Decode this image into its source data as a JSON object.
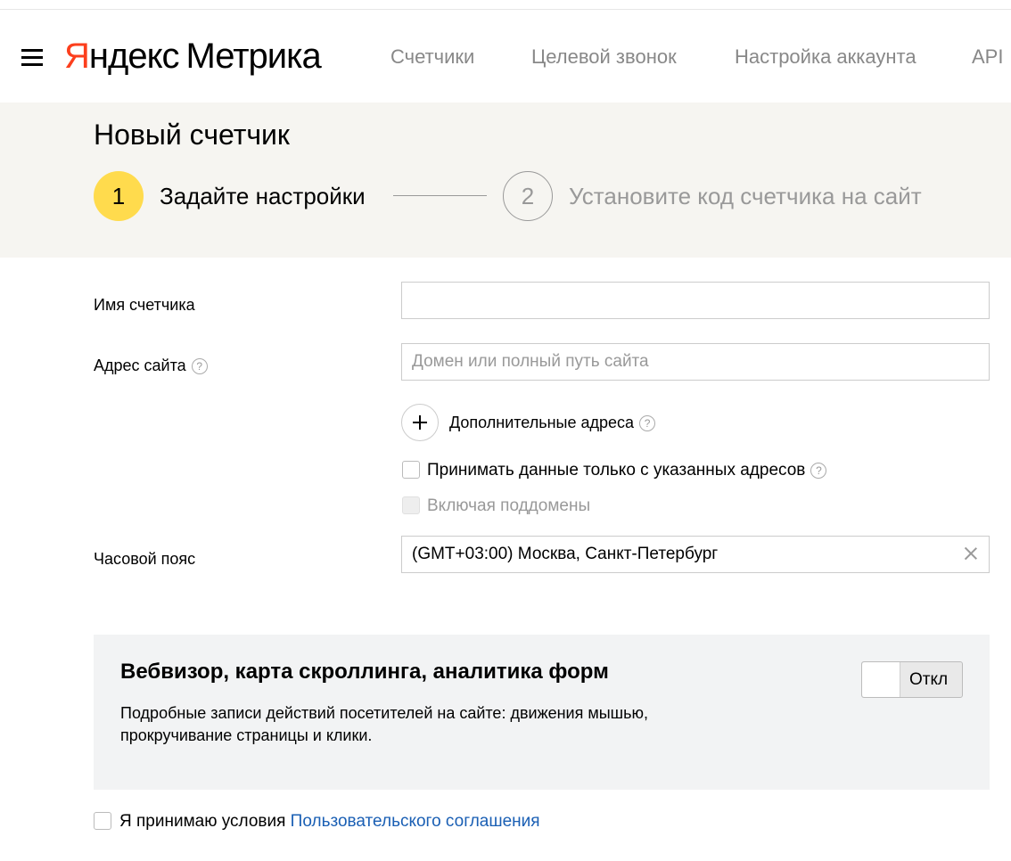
{
  "header": {
    "logo_part1": "Я",
    "logo_part2": "ндекс",
    "logo_product": "Метрика",
    "nav": [
      "Счетчики",
      "Целевой звонок",
      "Настройка аккаунта",
      "API"
    ]
  },
  "page": {
    "title": "Новый счетчик",
    "steps": [
      {
        "number": "1",
        "label": "Задайте настройки"
      },
      {
        "number": "2",
        "label": "Установите код счетчика на сайт"
      }
    ]
  },
  "form": {
    "counter_name_label": "Имя счетчика",
    "counter_name_value": "",
    "site_address_label": "Адрес сайта",
    "site_address_placeholder": "Домен или полный путь сайта",
    "extra_addresses_label": "Дополнительные адреса",
    "accept_only_label": "Принимать данные только с указанных адресов",
    "include_subdomains_label": "Включая поддомены",
    "timezone_label": "Часовой пояс",
    "timezone_value": "(GMT+03:00) Москва, Санкт-Петербург",
    "help_glyph": "?"
  },
  "webvisor": {
    "title": "Вебвизор, карта скроллинга, аналитика форм",
    "description": "Подробные записи действий посетителей на сайте: движения мышью, прокручивание страницы и клики.",
    "toggle_label": "Откл"
  },
  "agreement": {
    "prefix": "Я принимаю условия ",
    "link_text": "Пользовательского соглашения"
  },
  "colors": {
    "brand_red": "#fc3f1d",
    "step_active": "#ffdb4d",
    "band_bg": "#f6f5f1",
    "link": "#1a5fb4"
  }
}
